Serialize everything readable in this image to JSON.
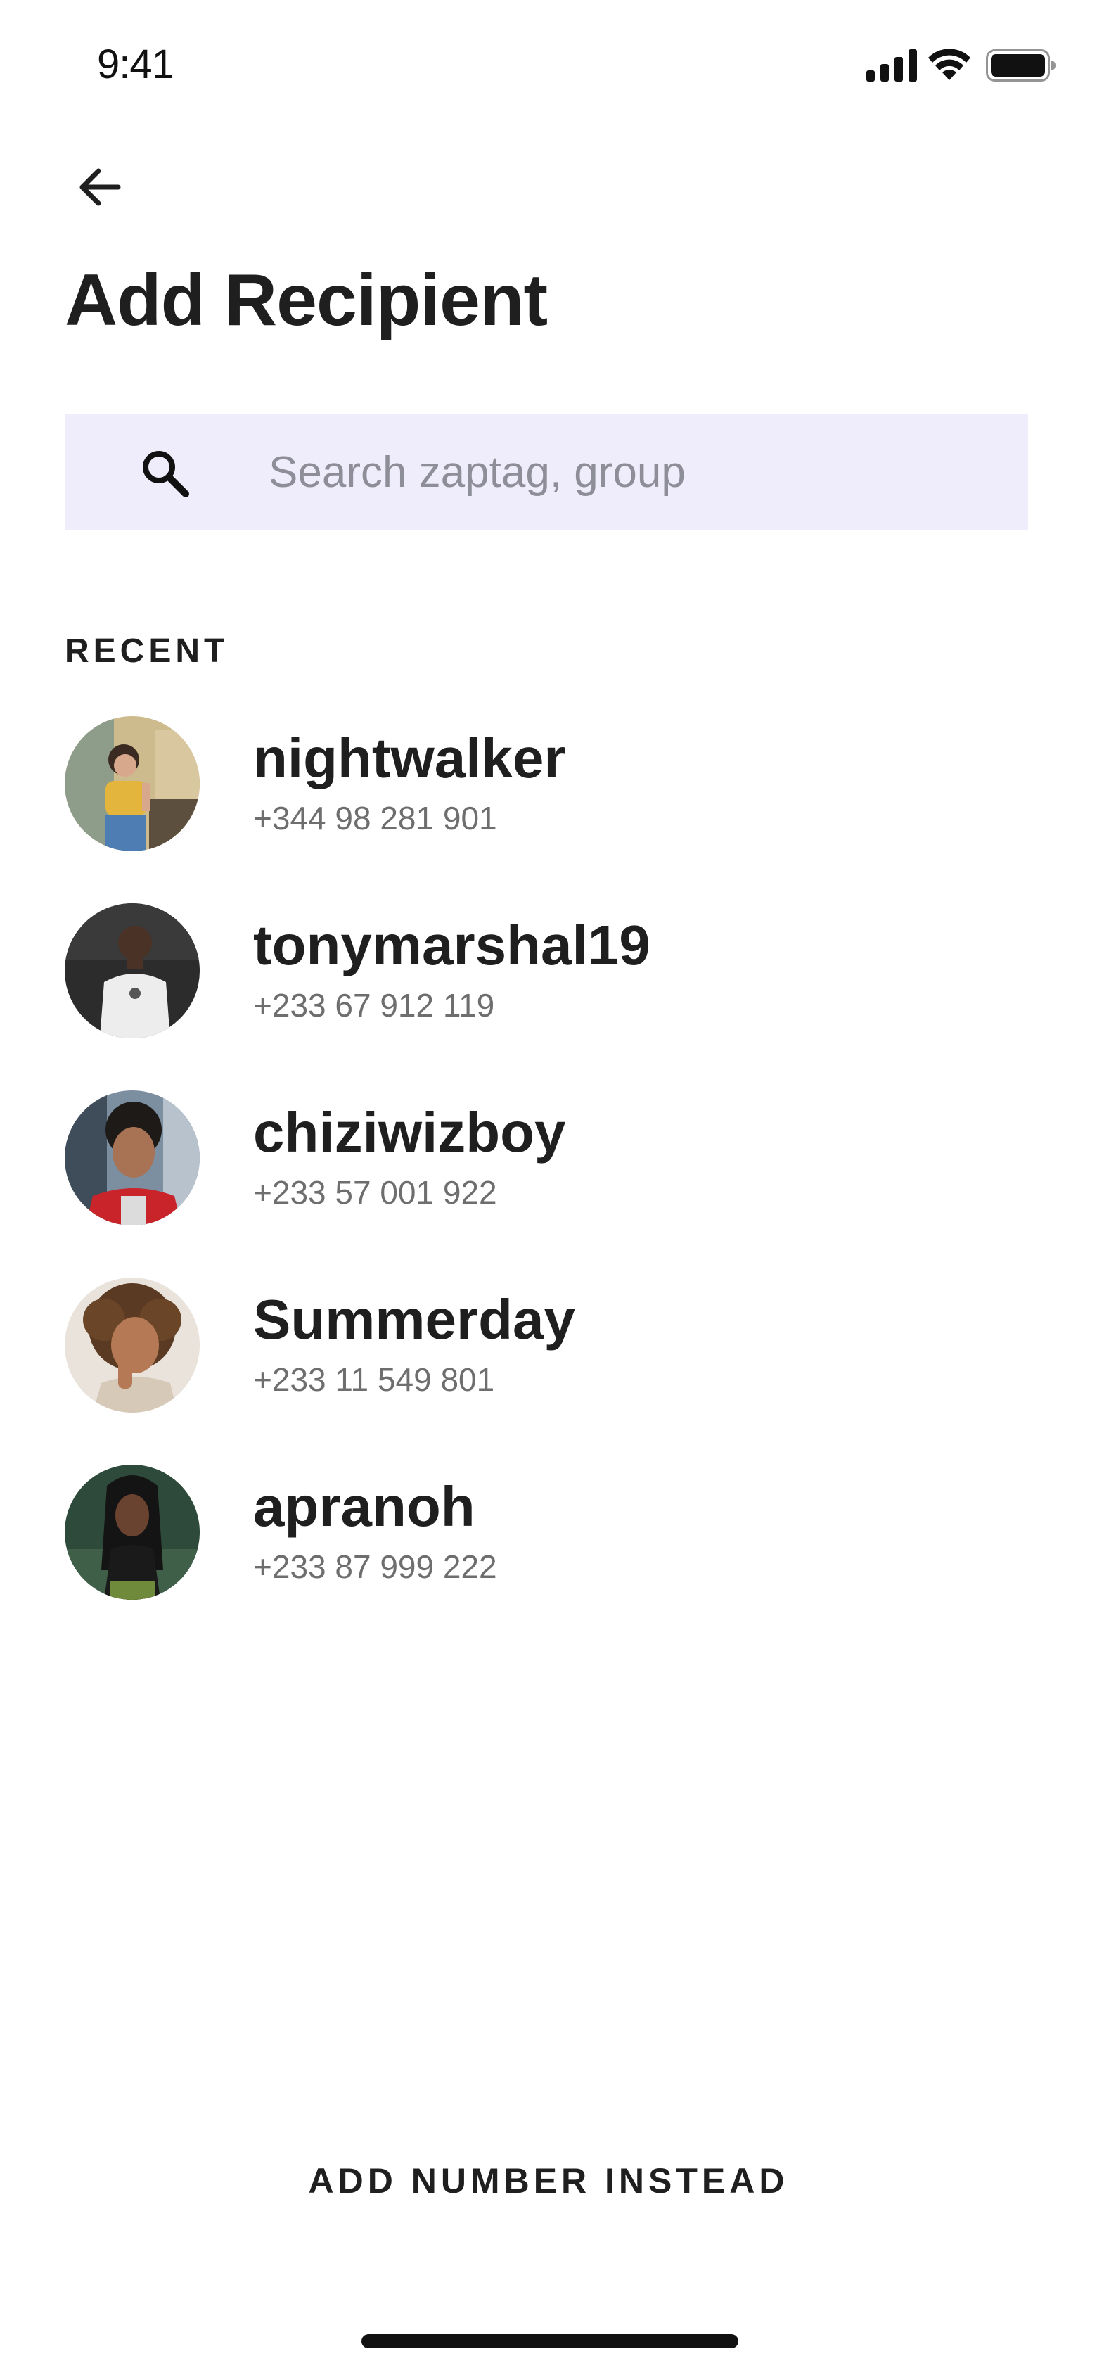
{
  "status_bar": {
    "time": "9:41",
    "icons": [
      "signal-icon",
      "wifi-icon",
      "battery-icon"
    ]
  },
  "header": {
    "back_icon": "arrow-left-icon",
    "title": "Add Recipient"
  },
  "search": {
    "icon": "search-icon",
    "placeholder": "Search zaptag, group",
    "value": ""
  },
  "recent": {
    "label": "RECENT",
    "contacts": [
      {
        "name": "nightwalker",
        "phone": "+344 98 281 901"
      },
      {
        "name": "tonymarshal19",
        "phone": "+233 67 912 119"
      },
      {
        "name": "chiziwizboy",
        "phone": "+233 57 001 922"
      },
      {
        "name": "Summerday",
        "phone": "+233 11 549 801"
      },
      {
        "name": "apranoh",
        "phone": "+233 87 999 222"
      }
    ]
  },
  "footer": {
    "add_number_label": "ADD NUMBER INSTEAD"
  },
  "colors": {
    "search_background": "#efedfb",
    "text_primary": "#1f1f1f",
    "text_secondary": "#6e6e6e",
    "placeholder": "#8e8e98"
  }
}
